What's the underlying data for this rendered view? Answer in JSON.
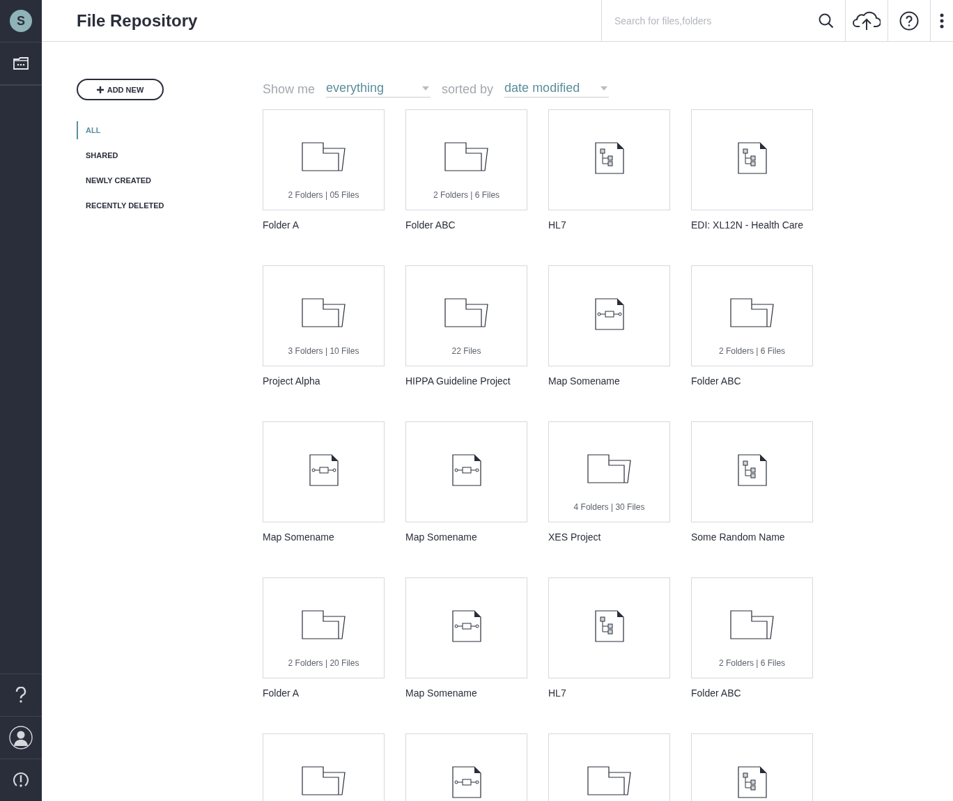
{
  "rail": {
    "avatar_letter": "S"
  },
  "header": {
    "title": "File Repository",
    "search": {
      "placeholder": "Search for files,folders"
    }
  },
  "add_button": "ADD NEW",
  "filters": [
    {
      "label": "ALL",
      "selected": true
    },
    {
      "label": "SHARED",
      "selected": false
    },
    {
      "label": "NEWLY CREATED",
      "selected": false
    },
    {
      "label": "RECENTLY DELETED",
      "selected": false
    }
  ],
  "toolbar": {
    "show_label": "Show me",
    "show_value": "everything",
    "sort_label": "sorted by",
    "sort_value": "date modified"
  },
  "items": [
    {
      "kind": "folder",
      "name": "Folder A",
      "count": "2 Folders | 05 Files"
    },
    {
      "kind": "folder",
      "name": "Folder ABC",
      "count": "2 Folders | 6 Files"
    },
    {
      "kind": "tree",
      "name": "HL7"
    },
    {
      "kind": "tree",
      "name": "EDI: XL12N - Health Care"
    },
    {
      "kind": "folder",
      "name": "Project Alpha",
      "count": "3 Folders | 10 Files"
    },
    {
      "kind": "folder",
      "name": "HIPPA Guideline Project",
      "count": "22 Files"
    },
    {
      "kind": "map",
      "name": "Map Somename"
    },
    {
      "kind": "folder",
      "name": "Folder ABC",
      "count": "2 Folders | 6 Files"
    },
    {
      "kind": "map",
      "name": "Map Somename"
    },
    {
      "kind": "map",
      "name": "Map Somename"
    },
    {
      "kind": "folder",
      "name": "XES Project",
      "count": "4 Folders | 30 Files"
    },
    {
      "kind": "tree",
      "name": "Some Random Name"
    },
    {
      "kind": "folder",
      "name": "Folder A",
      "count": "2 Folders | 20 Files"
    },
    {
      "kind": "map",
      "name": "Map Somename"
    },
    {
      "kind": "tree",
      "name": "HL7"
    },
    {
      "kind": "folder",
      "name": "Folder ABC",
      "count": "2 Folders | 6 Files"
    },
    {
      "kind": "folder"
    },
    {
      "kind": "map"
    },
    {
      "kind": "folder"
    },
    {
      "kind": "tree"
    }
  ]
}
